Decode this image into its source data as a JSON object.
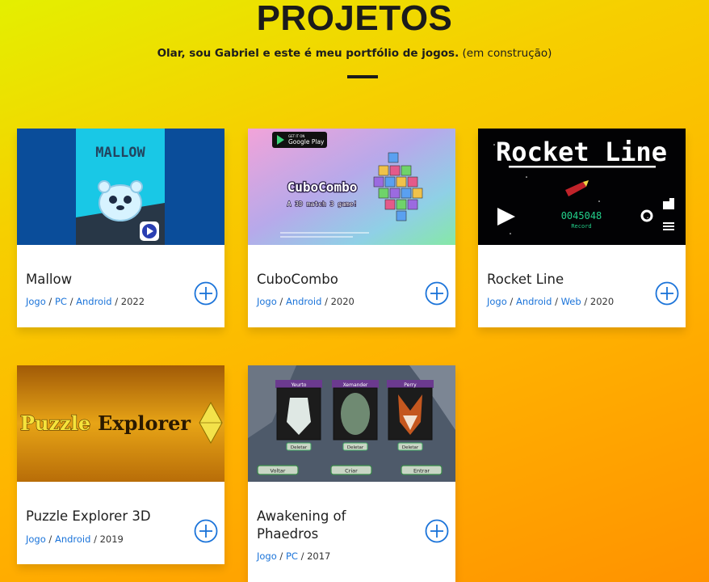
{
  "header": {
    "title": "PROJETOS",
    "subtitle_bold": "Olar, sou Gabriel e este é meu portfólio de jogos.",
    "subtitle_note": "(em construção)"
  },
  "projects": [
    {
      "name": "Mallow",
      "tags": [
        "Jogo",
        "PC",
        "Android"
      ],
      "year": "2022",
      "thumb_text": "MALLOW"
    },
    {
      "name": "CuboCombo",
      "tags": [
        "Jogo",
        "Android"
      ],
      "year": "2020",
      "thumb_text": "CuboCombo",
      "thumb_sub": "A 3D match 3 game!",
      "store_badge_small": "GET IT ON",
      "store_badge": "Google Play"
    },
    {
      "name": "Rocket Line",
      "tags": [
        "Jogo",
        "Android",
        "Web"
      ],
      "year": "2020",
      "thumb_text": "Rocket Line",
      "score": "0045048",
      "score_label": "Record"
    },
    {
      "name": "Puzzle Explorer 3D",
      "tags": [
        "Jogo",
        "Android"
      ],
      "year": "2019",
      "thumb_text_a": "Puzzle",
      "thumb_text_b": "Explorer"
    },
    {
      "name": "Awakening of Phaedros",
      "tags": [
        "Jogo",
        "PC"
      ],
      "year": "2017",
      "slots": [
        "Yeurto",
        "Xemander",
        "Perry"
      ],
      "slot_delete": "Deletar",
      "buttons": [
        "Voltar",
        "Criar",
        "Entrar"
      ]
    }
  ],
  "colors": {
    "link": "#1a73d9",
    "title": "#1b1b1b",
    "plus": "#1a73d9"
  }
}
